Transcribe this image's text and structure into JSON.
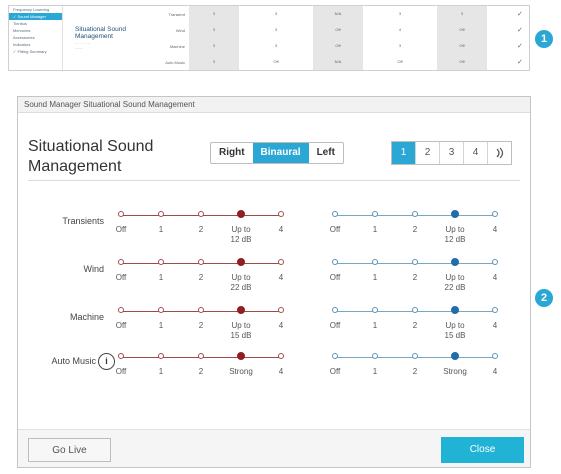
{
  "overview": {
    "nav_items": [
      {
        "label": "Frequency Lowering",
        "active": false
      },
      {
        "label": "✓ Sound Manager",
        "active": true
      },
      {
        "label": "Tinnitus",
        "active": false
      },
      {
        "label": "Memories",
        "active": false
      },
      {
        "label": "Accessories",
        "active": false
      },
      {
        "label": "Indicators",
        "active": false
      },
      {
        "label": "✓ Fitting Summary",
        "active": false
      }
    ],
    "section_title": "Situational Sound Management",
    "section_subtitle": "·· ·· ·· ·· ··",
    "section_link": "........",
    "rows": [
      {
        "label": "Transient",
        "cells": [
          "3",
          "3",
          "N/A",
          "3",
          "3"
        ]
      },
      {
        "label": "Wind",
        "cells": [
          "3",
          "3",
          "Off",
          "4",
          "Off"
        ]
      },
      {
        "label": "Machine",
        "cells": [
          "3",
          "3",
          "Off",
          "3",
          "Off"
        ]
      },
      {
        "label": "Auto Music",
        "cells": [
          "3",
          "Off",
          "N/A",
          "Off",
          "Off"
        ]
      }
    ],
    "check_mark": "✓",
    "badge": "1"
  },
  "dialog": {
    "title_bar": "Sound Manager Situational Sound Management",
    "heading_line1": "Situational Sound",
    "heading_line2": "Management",
    "ear_options": [
      {
        "label": "Right",
        "active": false
      },
      {
        "label": "Binaural",
        "active": true
      },
      {
        "label": "Left",
        "active": false
      }
    ],
    "program_tabs": [
      {
        "label": "1",
        "active": true
      },
      {
        "label": "2",
        "active": false
      },
      {
        "label": "3",
        "active": false
      },
      {
        "label": "4",
        "active": false
      },
      {
        "label": "streaming-icon",
        "active": false
      }
    ],
    "info_icon": "i",
    "rows": [
      {
        "name": "transients",
        "label": "Transients",
        "info": false,
        "selected": 3,
        "ticks": [
          "Off",
          "1",
          "2",
          "Up to\n12 dB",
          "4"
        ]
      },
      {
        "name": "wind",
        "label": "Wind",
        "info": false,
        "selected": 3,
        "ticks": [
          "Off",
          "1",
          "2",
          "Up to\n22 dB",
          "4"
        ]
      },
      {
        "name": "machine",
        "label": "Machine",
        "info": false,
        "selected": 3,
        "ticks": [
          "Off",
          "1",
          "2",
          "Up to\n15 dB",
          "4"
        ]
      },
      {
        "name": "auto-music",
        "label": "Auto Music",
        "info": true,
        "selected": 3,
        "ticks": [
          "Off",
          "1",
          "2",
          "Strong",
          "4"
        ]
      }
    ],
    "go_live_label": "Go Live",
    "close_label": "Close",
    "badge": "2"
  },
  "colors": {
    "accent": "#2aa7d4",
    "right_slider": "#8e1f24",
    "left_slider": "#1f6ea5"
  }
}
